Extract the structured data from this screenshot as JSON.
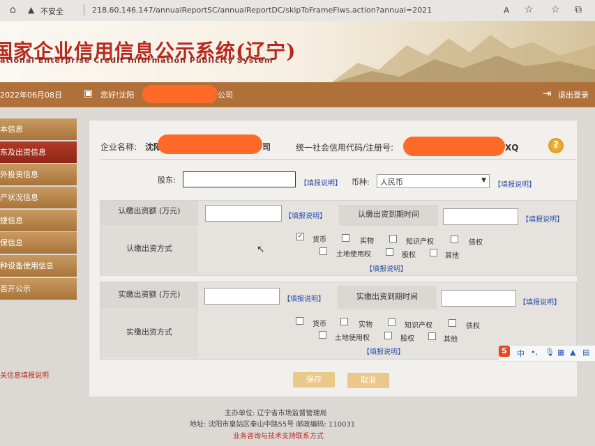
{
  "browser": {
    "warning": "不安全",
    "url": "218.60.146.147/annualReportSC/annualReportDC/skipToFrameFlws.action?annual=2021"
  },
  "header": {
    "title": "国家企业信用信息公示系统(辽宁)",
    "subtitle": "ational Enterprise Credit Information Publicity System"
  },
  "statusbar": {
    "date": "2022年06月08日",
    "greeting_prefix": "您好!沈阳",
    "greeting_suffix": "公司",
    "logout": "退出登录"
  },
  "sidebar": {
    "items": [
      {
        "label": "本信息",
        "active": false
      },
      {
        "label": "东及出资信息",
        "active": true
      },
      {
        "label": "外投资信息",
        "active": false
      },
      {
        "label": "产状况信息",
        "active": false
      },
      {
        "label": "捷信息",
        "active": false
      },
      {
        "label": "保信息",
        "active": false
      },
      {
        "label": "种设备使用信息",
        "active": false
      },
      {
        "label": "否开公示",
        "active": false
      }
    ],
    "note": "关信息填报说明"
  },
  "company": {
    "name_label": "企业名称:",
    "name_prefix": "沈阳",
    "name_suffix": "司",
    "code_label": "统一社会信用代码/注册号:",
    "code_suffix": "XQ",
    "help_icon": "?"
  },
  "form": {
    "shareholder_label": "股东:",
    "help": "【填报说明】",
    "currency_label": "币种:",
    "currency_value": "人民币",
    "subscribed": {
      "amount_label": "认缴出资额 (万元)",
      "date_label": "认缴出资到期时间",
      "method_label": "认缴出资方式",
      "options": [
        {
          "label": "货币",
          "checked": true
        },
        {
          "label": "实物",
          "checked": false
        },
        {
          "label": "知识产权",
          "checked": false
        },
        {
          "label": "债权",
          "checked": false
        },
        {
          "label": "土地使用权",
          "checked": false
        },
        {
          "label": "股权",
          "checked": false
        },
        {
          "label": "其他",
          "checked": false
        }
      ]
    },
    "paid": {
      "amount_label": "实缴出资额 (万元)",
      "date_label": "实缴出资到期时间",
      "method_label": "实缴出资方式",
      "options": [
        {
          "label": "货币",
          "checked": false
        },
        {
          "label": "实物",
          "checked": false
        },
        {
          "label": "知识产权",
          "checked": false
        },
        {
          "label": "债权",
          "checked": false
        },
        {
          "label": "土地使用权",
          "checked": false
        },
        {
          "label": "股权",
          "checked": false
        },
        {
          "label": "其他",
          "checked": false
        }
      ]
    },
    "save_label": "保存",
    "cancel_label": "取消"
  },
  "footer": {
    "host": "主办单位: 辽宁省市场监督管理局",
    "address": "地址: 沈阳市皇姑区泰山中路55号 邮政编码: 110031",
    "contact": "业务咨询与技术支持联系方式"
  },
  "ime": {
    "mode": "中",
    "punct": "•,"
  },
  "colors": {
    "brand_red": "#b8281e",
    "sidebar_brown": "#b0703a",
    "link_blue": "#2b4fa8",
    "redaction": "#ff6a28"
  }
}
